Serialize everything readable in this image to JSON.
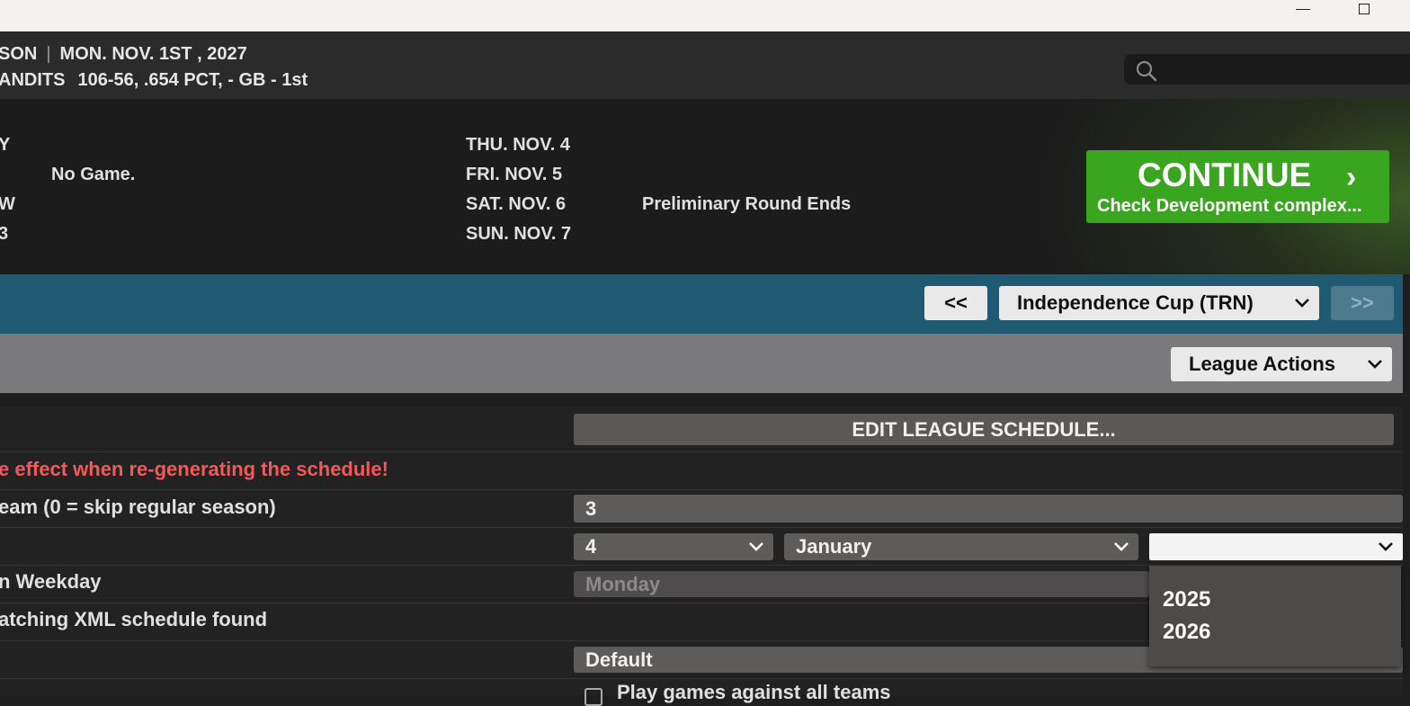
{
  "window": {
    "minimize_icon": "minimize-icon",
    "maximize_icon": "maximize-icon"
  },
  "header": {
    "season_fragment": "SON",
    "date": "MON. NOV. 1ST , 2027",
    "team_fragment": "ANDITS",
    "record": "106-56, .654 PCT, - GB - 1st",
    "search_icon": "search-icon"
  },
  "calendar": {
    "left_col": [
      "Y",
      "No Game.",
      "W",
      "3"
    ],
    "days": [
      "THU. NOV. 4",
      "FRI. NOV. 5",
      "SAT. NOV. 6",
      "SUN. NOV. 7"
    ],
    "event": "Preliminary Round Ends"
  },
  "continue_button": {
    "title": "CONTINUE",
    "subtitle": "Check Development complex...",
    "color": "#3aa61f"
  },
  "league_nav": {
    "prev": "<<",
    "league": "Independence Cup (TRN)",
    "next": ">>"
  },
  "actions": {
    "label": "League Actions"
  },
  "schedule": {
    "edit_button": "EDIT LEAGUE SCHEDULE...",
    "warning": "e effect when re-generating the schedule!",
    "games_label": "eam (0 = skip regular season)",
    "games_value": "3",
    "start_day": "4",
    "start_month": "January",
    "start_year": "",
    "year_options": [
      "2025",
      "2026"
    ],
    "weekday_label": "n Weekday",
    "weekday_value": "Monday",
    "xml_label": "atching XML schedule found",
    "type_value": "Default",
    "play_all_label": "Play games against all teams"
  }
}
